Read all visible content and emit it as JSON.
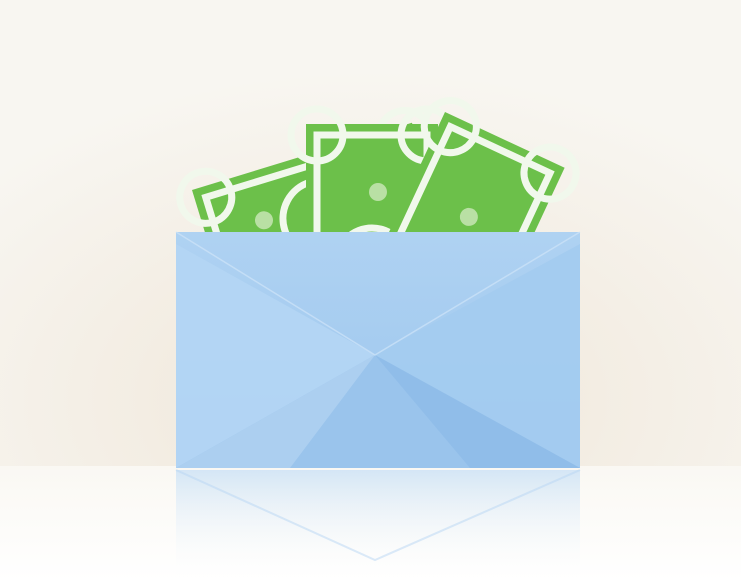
{
  "illustration": {
    "subject": "money-envelope",
    "icons": [
      "envelope-icon",
      "banknote-icon",
      "dollar-sign-icon"
    ],
    "banknote_count": 3,
    "currency_symbol": "$",
    "colors": {
      "background": "#f7f4ee",
      "floor": "#fbf9f6",
      "banknote_green": "#6cc04a",
      "banknote_dark": "#4f9a35",
      "banknote_line": "#f1f8ec",
      "envelope_blue": "#a9cdf0",
      "envelope_flap": "#92bfea",
      "envelope_shadow": "#86b6e6"
    }
  }
}
